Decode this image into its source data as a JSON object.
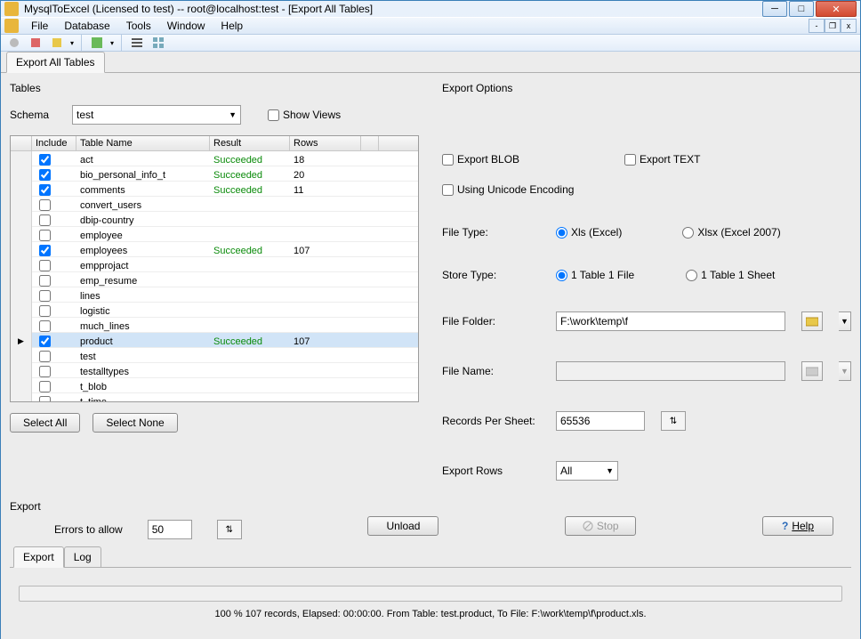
{
  "title": "MysqlToExcel (Licensed to test)  -- root@localhost:test - [Export All Tables]",
  "menu": {
    "file": "File",
    "database": "Database",
    "tools": "Tools",
    "window": "Window",
    "help": "Help"
  },
  "main_tab": "Export All Tables",
  "tables_panel": {
    "title": "Tables",
    "schema_label": "Schema",
    "schema_value": "test",
    "show_views": "Show Views",
    "columns": {
      "include": "Include",
      "table_name": "Table Name",
      "result": "Result",
      "rows": "Rows"
    },
    "rows": [
      {
        "checked": true,
        "name": "act",
        "result": "Succeeded",
        "rows": "18",
        "selected": false
      },
      {
        "checked": true,
        "name": "bio_personal_info_t",
        "result": "Succeeded",
        "rows": "20",
        "selected": false
      },
      {
        "checked": true,
        "name": "comments",
        "result": "Succeeded",
        "rows": "11",
        "selected": false
      },
      {
        "checked": false,
        "name": "convert_users",
        "result": "",
        "rows": "",
        "selected": false
      },
      {
        "checked": false,
        "name": "dbip-country",
        "result": "",
        "rows": "",
        "selected": false
      },
      {
        "checked": false,
        "name": "employee",
        "result": "",
        "rows": "",
        "selected": false
      },
      {
        "checked": true,
        "name": "employees",
        "result": "Succeeded",
        "rows": "107",
        "selected": false
      },
      {
        "checked": false,
        "name": "empprojact",
        "result": "",
        "rows": "",
        "selected": false
      },
      {
        "checked": false,
        "name": "emp_resume",
        "result": "",
        "rows": "",
        "selected": false
      },
      {
        "checked": false,
        "name": "lines",
        "result": "",
        "rows": "",
        "selected": false
      },
      {
        "checked": false,
        "name": "logistic",
        "result": "",
        "rows": "",
        "selected": false
      },
      {
        "checked": false,
        "name": "much_lines",
        "result": "",
        "rows": "",
        "selected": false
      },
      {
        "checked": true,
        "name": "product",
        "result": "Succeeded",
        "rows": "107",
        "selected": true
      },
      {
        "checked": false,
        "name": "test",
        "result": "",
        "rows": "",
        "selected": false
      },
      {
        "checked": false,
        "name": "testalltypes",
        "result": "",
        "rows": "",
        "selected": false
      },
      {
        "checked": false,
        "name": "t_blob",
        "result": "",
        "rows": "",
        "selected": false
      },
      {
        "checked": false,
        "name": "t_time",
        "result": "",
        "rows": "",
        "selected": false
      }
    ],
    "select_all": "Select All",
    "select_none": "Select None"
  },
  "options": {
    "title": "Export Options",
    "export_blob": "Export BLOB",
    "export_text": "Export TEXT",
    "unicode": "Using Unicode Encoding",
    "file_type_label": "File Type:",
    "file_type_xls": "Xls (Excel)",
    "file_type_xlsx": "Xlsx (Excel 2007)",
    "store_type_label": "Store Type:",
    "store_1file": "1 Table 1 File",
    "store_1sheet": "1 Table 1 Sheet",
    "file_folder_label": "File Folder:",
    "file_folder_value": "F:\\work\\temp\\f",
    "file_name_label": "File Name:",
    "file_name_value": "",
    "records_per_sheet_label": "Records Per Sheet:",
    "records_per_sheet_value": "65536",
    "export_rows_label": "Export Rows",
    "export_rows_value": "All"
  },
  "export_panel": {
    "title": "Export",
    "errors_label": "Errors to allow",
    "errors_value": "50",
    "unload": "Unload",
    "stop": "Stop",
    "help": "Help"
  },
  "bottom_tabs": {
    "export": "Export",
    "log": "Log"
  },
  "status": "100 %       107 records,    Elapsed: 00:00:00.    From Table: test.product,    To File: F:\\work\\temp\\f\\product.xls."
}
